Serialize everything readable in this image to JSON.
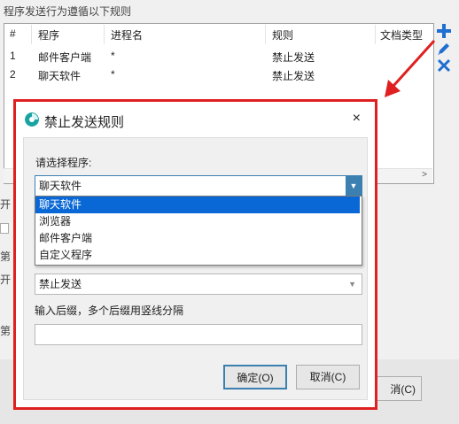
{
  "background": {
    "top_label": "程序发送行为遵循以下规则",
    "table": {
      "headers": [
        "#",
        "程序",
        "进程名",
        "规则",
        "文档类型"
      ],
      "rows": [
        [
          "1",
          "邮件客户端",
          "*",
          "禁止发送"
        ],
        [
          "2",
          "聊天软件",
          "*",
          "禁止发送"
        ]
      ]
    },
    "side_icons": [
      "add-icon",
      "edit-icon",
      "delete-icon"
    ],
    "left_fragments": [
      "开",
      "第",
      "开",
      "第"
    ],
    "cancel_fragment": "消(C)"
  },
  "dialog": {
    "title": "禁止发送规则",
    "close_glyph": "×",
    "program_label": "请选择程序:",
    "program_selected": "聊天软件",
    "dropdown_options": [
      "聊天软件",
      "浏览器",
      "邮件客户端",
      "自定义程序"
    ],
    "rule_selected": "禁止发送",
    "suffix_label": "输入后缀，多个后缀用竖线分隔",
    "suffix_value": "",
    "ok_label": "确定(O)",
    "cancel_label": "取消(C)"
  },
  "colors": {
    "highlight_red": "#e02020",
    "selection_blue": "#0a68d6",
    "accent_blue": "#1f6fd0"
  }
}
